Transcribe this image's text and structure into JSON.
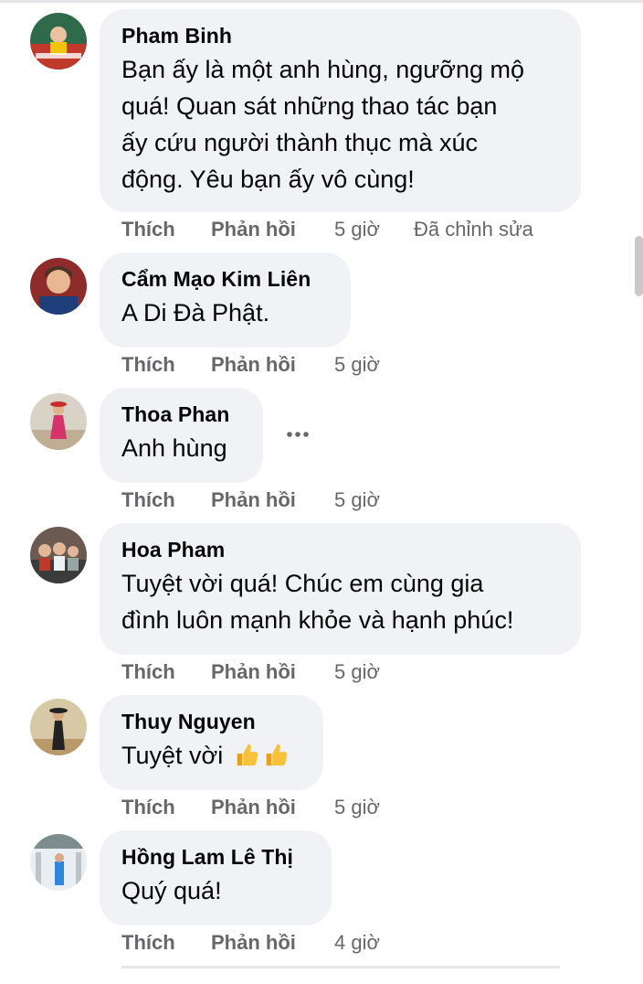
{
  "comments": [
    {
      "name": "Pham Binh",
      "lines": [
        "Bạn ấy là một anh hùng, ngưỡng mộ",
        "quá! Quan sát những thao tác bạn",
        "ấy cứu người thành thục mà xúc",
        "động. Yêu bạn ấy vô cùng!"
      ],
      "like": "Thích",
      "reply": "Phản hồi",
      "time": "5 giờ",
      "edited": "Đã chỉnh sửa"
    },
    {
      "name": "Cẩm Mạo Kim Liên",
      "lines": [
        "A Di Đà Phật."
      ],
      "like": "Thích",
      "reply": "Phản hồi",
      "time": "5 giờ"
    },
    {
      "name": "Thoa Phan",
      "lines": [
        "Anh hùng"
      ],
      "like": "Thích",
      "reply": "Phản hồi",
      "time": "5 giờ"
    },
    {
      "name": "Hoa Pham",
      "lines": [
        "Tuyệt vời quá! Chúc em cùng gia",
        "đình luôn mạnh khỏe và hạnh phúc!"
      ],
      "like": "Thích",
      "reply": "Phản hồi",
      "time": "5 giờ"
    },
    {
      "name": "Thuy Nguyen",
      "lines": [
        "Tuyệt vời"
      ],
      "emoji": "thumbs-up-emoji x2",
      "like": "Thích",
      "reply": "Phản hồi",
      "time": "5 giờ"
    },
    {
      "name": "Hồng Lam Lê Thị",
      "lines": [
        "Quý quá!"
      ],
      "like": "Thích",
      "reply": "Phản hồi",
      "time": "4 giờ"
    }
  ],
  "colors": {
    "bubble": "#f0f2f5",
    "meta": "#65676b",
    "text": "#050505"
  }
}
